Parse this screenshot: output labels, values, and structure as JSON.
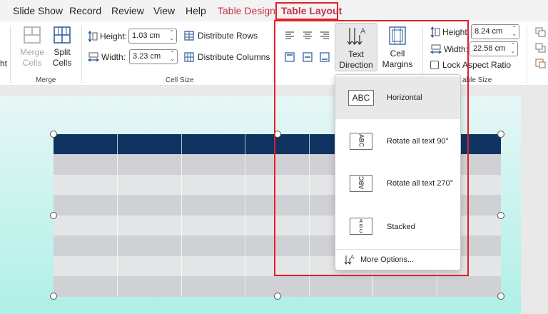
{
  "menu": {
    "slide_show": "Slide Show",
    "record": "Record",
    "review": "Review",
    "view": "View",
    "help": "Help",
    "table_design": "Table Design",
    "table_layout": "Table Layout"
  },
  "ribbon": {
    "partial_left_label": "ht",
    "merge": {
      "merge_cells_1": "Merge",
      "merge_cells_2": "Cells",
      "split_cells_1": "Split",
      "split_cells_2": "Cells",
      "group_label": "Merge"
    },
    "cell_size": {
      "height_label": "Height:",
      "height_value": "1.03 cm",
      "width_label": "Width:",
      "width_value": "3.23 cm",
      "distribute_rows": "Distribute Rows",
      "distribute_columns": "Distribute Columns",
      "group_label": "Cell Size"
    },
    "alignment": {
      "text_direction_1": "Text",
      "text_direction_2": "Direction",
      "cell_margins_1": "Cell",
      "cell_margins_2": "Margins"
    },
    "table_size": {
      "height_label": "Height:",
      "height_value": "8.24 cm",
      "width_label": "Width:",
      "width_value": "22.58 cm",
      "lock_aspect": "Lock Aspect Ratio",
      "group_label_partial": "able Size"
    }
  },
  "dropdown": {
    "items": [
      {
        "icon_text": "ABC",
        "label": "Horizontal",
        "selected": true
      },
      {
        "icon_text": "ABC",
        "label": "Rotate all text 90°",
        "selected": false
      },
      {
        "icon_text": "ABC",
        "label": "Rotate all text 270°",
        "selected": false
      },
      {
        "icon_text": "A B C",
        "label": "Stacked",
        "selected": false
      }
    ],
    "more_options": "More Options..."
  },
  "colors": {
    "accent_red": "#c4314b",
    "highlight_red": "#e21f26",
    "table_header": "#0f3461",
    "table_row_dark": "#cfd1d4",
    "table_row_light": "#e5e6e8"
  }
}
